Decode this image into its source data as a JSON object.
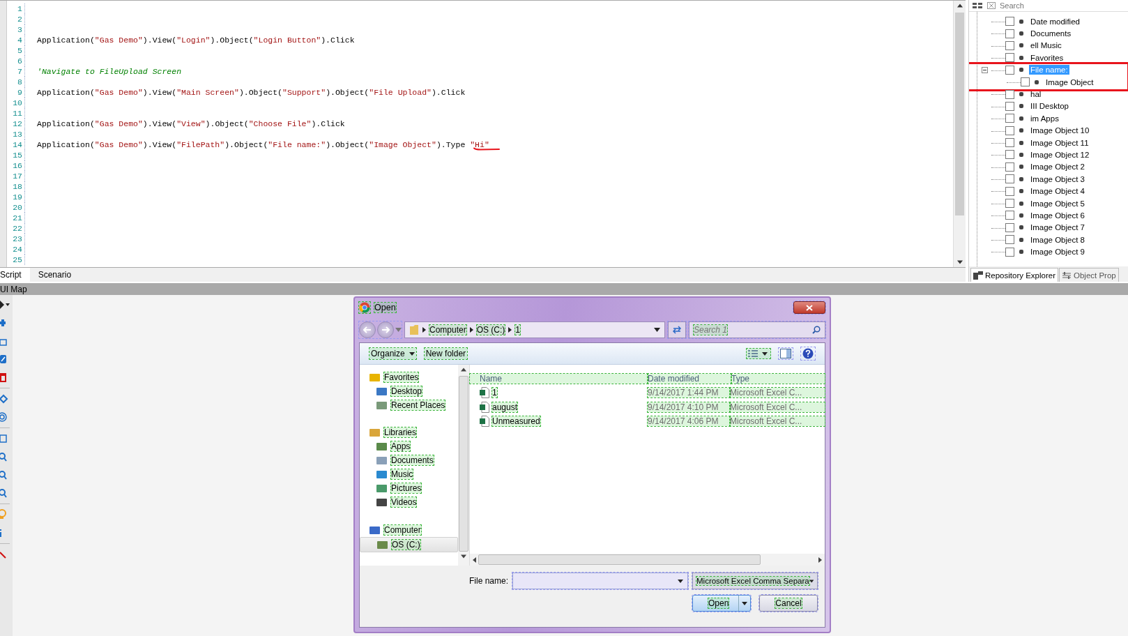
{
  "editor": {
    "lines": [
      {
        "number": "1"
      },
      {
        "number": "2"
      },
      {
        "number": "3"
      },
      {
        "number": "4",
        "tokens": [
          {
            "kind": "plain",
            "text": "Application("
          },
          {
            "kind": "string",
            "text": "\"Gas Demo\""
          },
          {
            "kind": "plain",
            "text": ").View("
          },
          {
            "kind": "string",
            "text": "\"Login\""
          },
          {
            "kind": "plain",
            "text": ").Object("
          },
          {
            "kind": "string",
            "text": "\"Login Button\""
          },
          {
            "kind": "plain",
            "text": ").Click"
          }
        ]
      },
      {
        "number": "5"
      },
      {
        "number": "6"
      },
      {
        "number": "7",
        "tokens": [
          {
            "kind": "comment",
            "text": "'Navigate to FileUpload Screen"
          }
        ]
      },
      {
        "number": "8"
      },
      {
        "number": "9",
        "tokens": [
          {
            "kind": "plain",
            "text": "Application("
          },
          {
            "kind": "string",
            "text": "\"Gas Demo\""
          },
          {
            "kind": "plain",
            "text": ").View("
          },
          {
            "kind": "string",
            "text": "\"Main Screen\""
          },
          {
            "kind": "plain",
            "text": ").Object("
          },
          {
            "kind": "string",
            "text": "\"Support\""
          },
          {
            "kind": "plain",
            "text": ").Object("
          },
          {
            "kind": "string",
            "text": "\"File Upload\""
          },
          {
            "kind": "plain",
            "text": ").Click"
          }
        ]
      },
      {
        "number": "10"
      },
      {
        "number": "11"
      },
      {
        "number": "12",
        "tokens": [
          {
            "kind": "plain",
            "text": "Application("
          },
          {
            "kind": "string",
            "text": "\"Gas Demo\""
          },
          {
            "kind": "plain",
            "text": ").View("
          },
          {
            "kind": "string",
            "text": "\"View\""
          },
          {
            "kind": "plain",
            "text": ").Object("
          },
          {
            "kind": "string",
            "text": "\"Choose File\""
          },
          {
            "kind": "plain",
            "text": ").Click"
          }
        ]
      },
      {
        "number": "13"
      },
      {
        "number": "14",
        "underlined": true,
        "tokens": [
          {
            "kind": "plain",
            "text": "Application("
          },
          {
            "kind": "string",
            "text": "\"Gas Demo\""
          },
          {
            "kind": "plain",
            "text": ").View("
          },
          {
            "kind": "string",
            "text": "\"FilePath\""
          },
          {
            "kind": "plain",
            "text": ").Object("
          },
          {
            "kind": "string",
            "text": "\"File name:\""
          },
          {
            "kind": "plain",
            "text": ").Object("
          },
          {
            "kind": "string",
            "text": "\"Image Object\""
          },
          {
            "kind": "plain",
            "text": ").Type "
          },
          {
            "kind": "string",
            "text": "\"Hi\""
          }
        ]
      },
      {
        "number": "15"
      },
      {
        "number": "16"
      },
      {
        "number": "17"
      },
      {
        "number": "18"
      },
      {
        "number": "19"
      },
      {
        "number": "20"
      },
      {
        "number": "21"
      },
      {
        "number": "22"
      },
      {
        "number": "23"
      },
      {
        "number": "24"
      },
      {
        "number": "25"
      }
    ]
  },
  "editor_tabs": [
    {
      "label": "Script",
      "selected": true
    },
    {
      "label": "Scenario",
      "selected": false
    }
  ],
  "repository": {
    "search": {
      "placeholder": "Search"
    },
    "tree": [
      {
        "label": "Date modified",
        "checked": false,
        "selected": false,
        "highlighted": false
      },
      {
        "label": "Documents",
        "checked": false,
        "selected": false,
        "highlighted": false
      },
      {
        "label": "ell Music",
        "checked": false,
        "selected": false,
        "highlighted": false
      },
      {
        "label": "Favorites",
        "checked": false,
        "selected": false,
        "highlighted": false
      },
      {
        "label": "File name:",
        "checked": false,
        "selected": true,
        "highlighted": true,
        "expanded": true,
        "children": [
          {
            "label": "Image Object",
            "checked": false,
            "selected": false,
            "highlighted": false
          }
        ]
      },
      {
        "label": "hal",
        "checked": false,
        "selected": false,
        "highlighted": false
      },
      {
        "label": "III Desktop",
        "checked": false,
        "selected": false,
        "highlighted": false
      },
      {
        "label": "im Apps",
        "checked": false,
        "selected": false,
        "highlighted": false
      },
      {
        "label": "Image Object 10",
        "checked": false,
        "selected": false,
        "highlighted": false
      },
      {
        "label": "Image Object 11",
        "checked": false,
        "selected": false,
        "highlighted": false
      },
      {
        "label": "Image Object 12",
        "checked": false,
        "selected": false,
        "highlighted": false
      },
      {
        "label": "Image Object 2",
        "checked": false,
        "selected": false,
        "highlighted": false
      },
      {
        "label": "Image Object 3",
        "checked": false,
        "selected": false,
        "highlighted": false
      },
      {
        "label": "Image Object 4",
        "checked": false,
        "selected": false,
        "highlighted": false
      },
      {
        "label": "Image Object 5",
        "checked": false,
        "selected": false,
        "highlighted": false
      },
      {
        "label": "Image Object 6",
        "checked": false,
        "selected": false,
        "highlighted": false
      },
      {
        "label": "Image Object 7",
        "checked": false,
        "selected": false,
        "highlighted": false
      },
      {
        "label": "Image Object 8",
        "checked": false,
        "selected": false,
        "highlighted": false
      },
      {
        "label": "Image Object 9",
        "checked": false,
        "selected": false,
        "highlighted": false
      }
    ],
    "tabs": [
      {
        "label": "Repository Explorer",
        "selected": true
      },
      {
        "label": "Object Prop",
        "selected": false
      }
    ]
  },
  "ui_map": {
    "title": "UI Map"
  },
  "dialog": {
    "title": "Open",
    "breadcrumb": [
      "Computer",
      "OS (C:)",
      "1"
    ],
    "search": {
      "placeholder": "Search 1"
    },
    "toolbar": {
      "organize": "Organize",
      "new_folder": "New folder"
    },
    "nav": [
      {
        "label": "Favorites",
        "kind": "favorites",
        "selected": false,
        "children": [
          {
            "label": "Desktop",
            "kind": "desktop",
            "selected": false
          },
          {
            "label": "Recent Places",
            "kind": "recent",
            "selected": false
          }
        ]
      },
      {
        "label": "Libraries",
        "kind": "libraries",
        "selected": false,
        "children": [
          {
            "label": "Apps",
            "kind": "apps",
            "selected": false
          },
          {
            "label": "Documents",
            "kind": "documents",
            "selected": false
          },
          {
            "label": "Music",
            "kind": "music",
            "selected": false
          },
          {
            "label": "Pictures",
            "kind": "pictures",
            "selected": false
          },
          {
            "label": "Videos",
            "kind": "videos",
            "selected": false
          }
        ]
      },
      {
        "label": "Computer",
        "kind": "computer",
        "selected": false,
        "children": [
          {
            "label": "OS (C:)",
            "kind": "drive",
            "selected": true
          }
        ]
      }
    ],
    "columns": [
      "Name",
      "Date modified",
      "Type"
    ],
    "files": [
      {
        "name": "1",
        "date": "9/14/2017 1:44 PM",
        "type": "Microsoft Excel C..."
      },
      {
        "name": "august",
        "date": "9/14/2017 4:10 PM",
        "type": "Microsoft Excel C..."
      },
      {
        "name": "Unmeasured",
        "date": "9/14/2017 4:06 PM",
        "type": "Microsoft Excel C..."
      }
    ],
    "file_name_label": "File name:",
    "file_type": "Microsoft Excel Comma Separa",
    "buttons": {
      "open": "Open",
      "cancel": "Cancel"
    }
  }
}
